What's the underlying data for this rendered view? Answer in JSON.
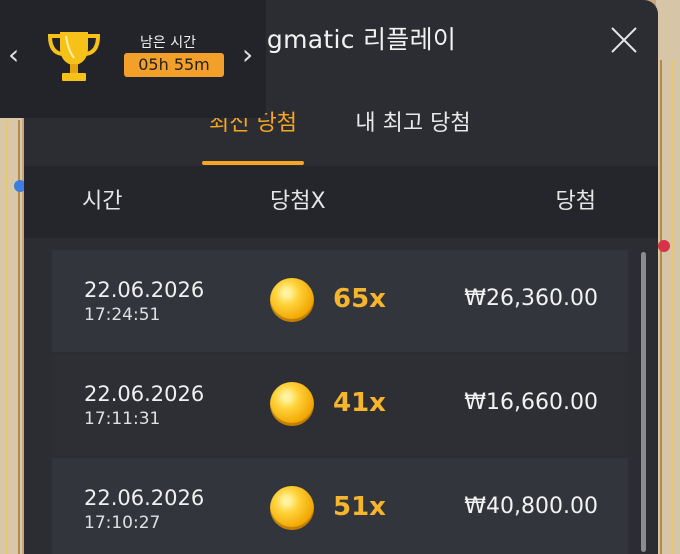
{
  "title": "Pragmatic 리플레이",
  "close_icon": "close-icon",
  "tabs": [
    {
      "label": "최신 당첨",
      "active": true
    },
    {
      "label": "내 최고 당첨",
      "active": false
    }
  ],
  "columns": {
    "time": "시간",
    "multiplier": "당첨X",
    "win": "당첨"
  },
  "rows": [
    {
      "date": "22.06.2026",
      "time": "17:24:51",
      "multiplier": "65x",
      "amount": "₩26,360.00"
    },
    {
      "date": "22.06.2026",
      "time": "17:11:31",
      "multiplier": "41x",
      "amount": "₩16,660.00"
    },
    {
      "date": "22.06.2026",
      "time": "17:10:27",
      "multiplier": "51x",
      "amount": "₩40,800.00"
    }
  ],
  "tournament": {
    "label": "남은 시간",
    "remaining": "05h 55m",
    "left_arrow": "‹",
    "right_arrow": "›",
    "icon": "trophy-icon"
  },
  "colors": {
    "accent": "#f5a623",
    "panel": "#2b2d33",
    "coin": "#ffd23a"
  }
}
